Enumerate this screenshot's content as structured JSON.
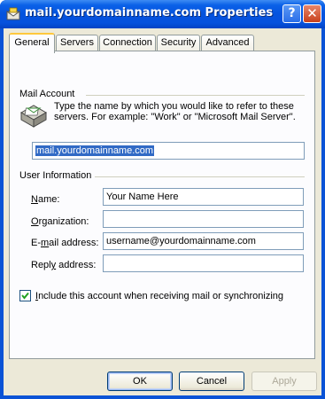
{
  "window": {
    "title": "mail.yourdomainname.com Properties",
    "help_glyph": "?",
    "close_glyph": "✕"
  },
  "tabs": [
    {
      "label": "General",
      "active": true
    },
    {
      "label": "Servers",
      "active": false
    },
    {
      "label": "Connection",
      "active": false
    },
    {
      "label": "Security",
      "active": false
    },
    {
      "label": "Advanced",
      "active": false
    }
  ],
  "mail_account": {
    "group_label": "Mail Account",
    "description": "Type the name by which you would like to refer to these servers.  For example: \"Work\" or \"Microsoft Mail Server\".",
    "account_name": "mail.yourdomainname.com",
    "icon": "mail-account-icon"
  },
  "user_info": {
    "group_label": "User Information",
    "name_label": "Name:",
    "name_value": "Your Name Here",
    "org_label": "Organization:",
    "org_value": "",
    "email_label": "E-mail address:",
    "email_value": "username@yourdomainname.com",
    "reply_label": "Reply address:",
    "reply_value": ""
  },
  "include_checkbox": {
    "label": "Include this account when receiving mail or synchronizing",
    "checked": true
  },
  "buttons": {
    "ok": "OK",
    "cancel": "Cancel",
    "apply": "Apply"
  },
  "colors": {
    "title_bar": "#0453de",
    "dialog_bg": "#ece9d8",
    "selection": "#316ac5",
    "tab_highlight": "#ffc83c"
  }
}
